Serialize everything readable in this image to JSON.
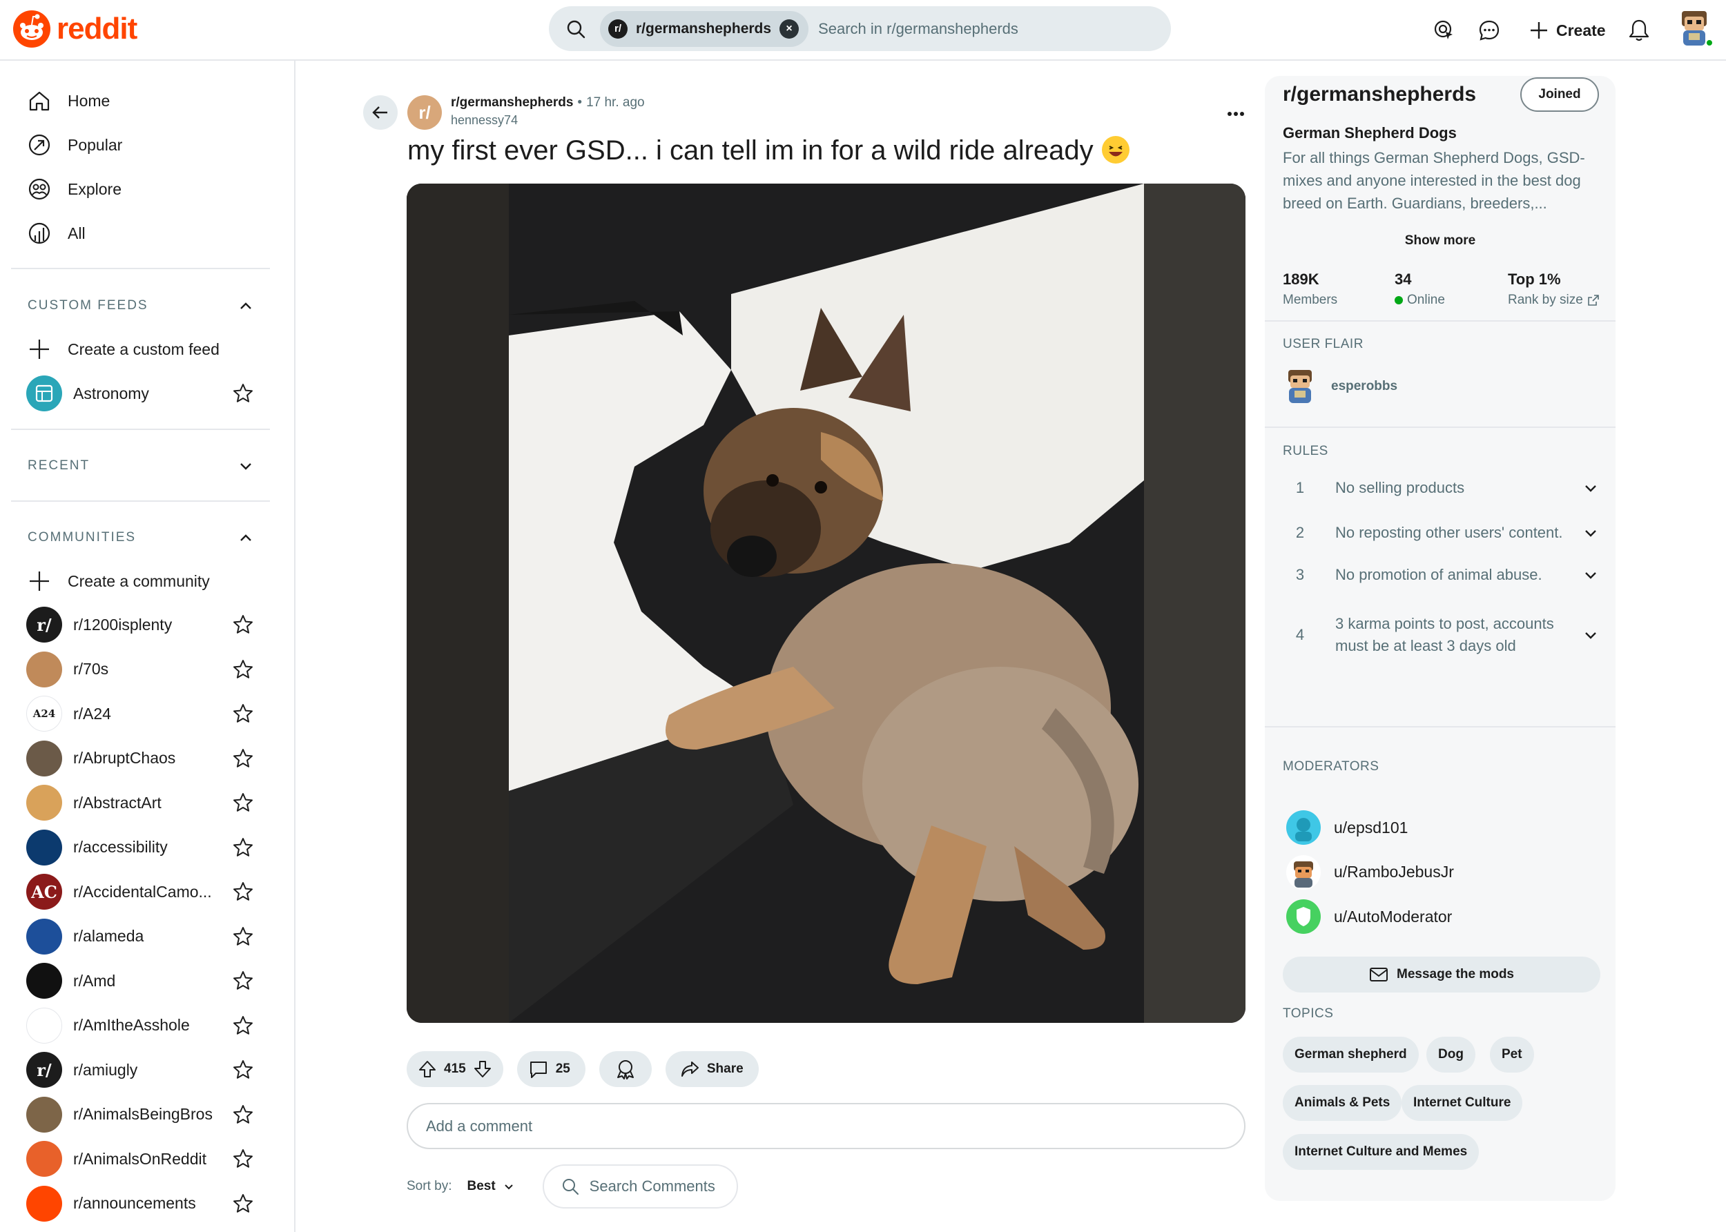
{
  "brand": {
    "logo_text": "reddit",
    "accent": "#ff4500"
  },
  "search": {
    "chip_label": "r/germanshepherds",
    "chip_avatar": "r/",
    "placeholder": "Search in r/germanshepherds"
  },
  "header_actions": {
    "ads_icon": "advertise-icon",
    "chat_icon": "chat-icon",
    "create_label": "Create",
    "bell_icon": "notifications-icon"
  },
  "nav": {
    "home": "Home",
    "popular": "Popular",
    "explore": "Explore",
    "all": "All",
    "custom_feeds_title": "CUSTOM FEEDS",
    "create_custom_feed": "Create a custom feed",
    "astronomy": "Astronomy",
    "recent_title": "RECENT",
    "communities_title": "COMMUNITIES",
    "create_community": "Create a community",
    "communities": [
      {
        "name": "r/1200isplenty",
        "color": "#1c1c1c",
        "glyph": "r/"
      },
      {
        "name": "r/70s",
        "color": "#c08a5a",
        "glyph": ""
      },
      {
        "name": "r/A24",
        "color": "#ffffff",
        "glyph": "A24"
      },
      {
        "name": "r/AbruptChaos",
        "color": "#6b5a48",
        "glyph": ""
      },
      {
        "name": "r/AbstractArt",
        "color": "#d9a25a",
        "glyph": ""
      },
      {
        "name": "r/accessibility",
        "color": "#0c3a6e",
        "glyph": ""
      },
      {
        "name": "r/AccidentalCamo...",
        "color": "#8b1a1a",
        "glyph": "AC"
      },
      {
        "name": "r/alameda",
        "color": "#1d4f9a",
        "glyph": ""
      },
      {
        "name": "r/Amd",
        "color": "#111111",
        "glyph": ""
      },
      {
        "name": "r/AmItheAsshole",
        "color": "#ffffff",
        "glyph": ""
      },
      {
        "name": "r/amiugly",
        "color": "#1c1c1c",
        "glyph": "r/"
      },
      {
        "name": "r/AnimalsBeingBros",
        "color": "#7d6548",
        "glyph": ""
      },
      {
        "name": "r/AnimalsOnReddit",
        "color": "#e8612a",
        "glyph": ""
      },
      {
        "name": "r/announcements",
        "color": "#ff4500",
        "glyph": ""
      }
    ]
  },
  "post": {
    "subreddit": "r/germanshepherds",
    "sub_avatar": "r/",
    "time": "17 hr. ago",
    "author": "hennessy74",
    "title": "my first ever GSD... i can tell im in for a wild ride already",
    "upvotes": "415",
    "comments": "25",
    "share_label": "Share",
    "comment_placeholder": "Add a comment",
    "sort_label": "Sort by:",
    "sort_value": "Best",
    "search_comments": "Search Comments"
  },
  "sidebar": {
    "title": "r/germanshepherds",
    "joined_label": "Joined",
    "subtitle": "German Shepherd Dogs",
    "description": "For all things German Shepherd Dogs, GSD-mixes and anyone interested in the best dog breed on Earth. Guardians, breeders,...",
    "show_more": "Show more",
    "stats": [
      {
        "value": "189K",
        "label": "Members"
      },
      {
        "value": "34",
        "label": "Online"
      },
      {
        "value": "Top 1%",
        "label": "Rank by size"
      }
    ],
    "user_flair_title": "USER FLAIR",
    "flair_user": "esperobbs",
    "rules_title": "RULES",
    "rules": [
      {
        "num": "1",
        "text": "No selling products"
      },
      {
        "num": "2",
        "text": "No reposting other users' content."
      },
      {
        "num": "3",
        "text": "No promotion of animal abuse."
      },
      {
        "num": "4",
        "text": "3 karma points to post, accounts must be at least 3 days old"
      }
    ],
    "moderators_title": "MODERATORS",
    "moderators": [
      {
        "name": "u/epsd101",
        "color": "#3fc7e6"
      },
      {
        "name": "u/RamboJebusJr",
        "color": "#ffffff"
      },
      {
        "name": "u/AutoModerator",
        "color": "#46d160"
      }
    ],
    "message_mods": "Message the mods",
    "topics_title": "TOPICS",
    "topics": [
      "German shepherd",
      "Dog",
      "Pet",
      "Animals & Pets",
      "Internet Culture",
      "Internet Culture and Memes"
    ]
  }
}
